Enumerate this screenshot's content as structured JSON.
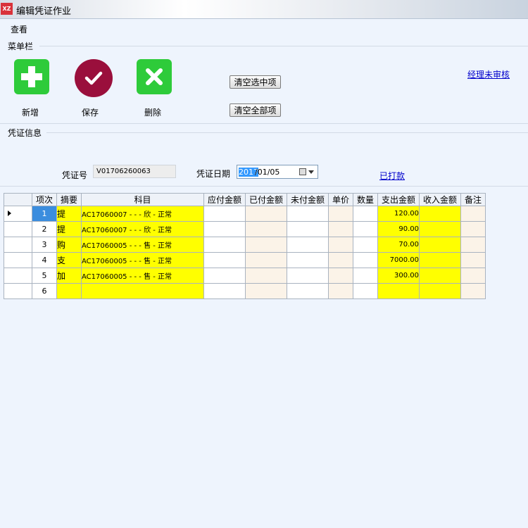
{
  "window": {
    "icon_text": "XZ",
    "title": "编辑凭证作业"
  },
  "menu": {
    "view": "查看"
  },
  "toolbar_section": "菜单栏",
  "tools": {
    "add": "新增",
    "save": "保存",
    "delete": "删除",
    "clear_selected": "清空选中项",
    "clear_all": "清空全部项"
  },
  "manager_link": "经理未审核",
  "voucher_section": "凭证信息",
  "voucher": {
    "no_label": "凭证号",
    "no_value": "V01706260063",
    "date_label": "凭证日期",
    "date_year_selected": "2017",
    "date_rest": "/01/05",
    "paid_link": "已打款"
  },
  "columns": [
    "项次",
    "摘要",
    "科目",
    "应付金额",
    "已付金额",
    "未付金额",
    "单价",
    "数量",
    "支出金额",
    "收入金额",
    "备注"
  ],
  "rows": [
    {
      "idx": "1",
      "summary": "提",
      "subject": "AC17060007 - - - 欣 - 正常",
      "expense": "120.00",
      "current": true
    },
    {
      "idx": "2",
      "summary": "提",
      "subject": "AC17060007 - - - 欣 - 正常",
      "expense": "90.00"
    },
    {
      "idx": "3",
      "summary": "购",
      "subject": "AC17060005 - - - 售 - 正常",
      "expense": "70.00"
    },
    {
      "idx": "4",
      "summary": "支",
      "subject": "AC17060005 - - - 售 - 正常",
      "expense": "7000.00"
    },
    {
      "idx": "5",
      "summary": "加",
      "subject": "AC17060005 - - - 售 - 正常",
      "expense": "300.00"
    },
    {
      "idx": "6",
      "summary": "",
      "subject": "",
      "expense": ""
    }
  ],
  "colors": {
    "highlight": "#ffff00",
    "add_green": "#2ecb3a",
    "save_red": "#9a0f3c",
    "selected_index": "#3b8dde"
  }
}
